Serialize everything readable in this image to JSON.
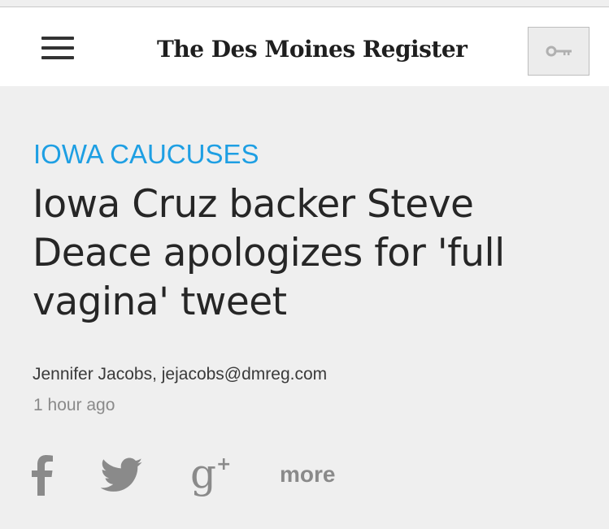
{
  "header": {
    "masthead": "The Des Moines Register",
    "menu_icon": "hamburger-menu-icon",
    "login_icon": "key-icon"
  },
  "article": {
    "section": "IOWA CAUCUSES",
    "headline": "Iowa Cruz backer Steve Deace apologizes for 'full vagina' tweet",
    "byline": "Jennifer Jacobs, jejacobs@dmreg.com",
    "timestamp": "1 hour ago"
  },
  "share": {
    "icons": [
      "facebook-icon",
      "twitter-icon",
      "google-plus-icon"
    ],
    "more_label": "more"
  },
  "colors": {
    "section_accent": "#1e9fe3",
    "icon_gray": "#8a8a8a",
    "page_background": "#efefef",
    "header_background": "#ffffff"
  }
}
